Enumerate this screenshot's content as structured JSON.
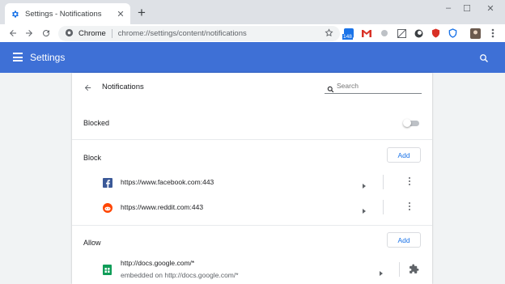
{
  "browser": {
    "tab_title": "Settings - Notifications",
    "omnibox_scheme": "Chrome",
    "omnibox_url": "chrome://settings/content/notifications",
    "extension_badge": "148"
  },
  "header": {
    "title": "Settings"
  },
  "page": {
    "title": "Notifications",
    "search_placeholder": "Search",
    "blocked_label": "Blocked",
    "blocked_toggle_on": false
  },
  "block_section": {
    "heading": "Block",
    "add_label": "Add",
    "sites": [
      {
        "url": "https://www.facebook.com:443",
        "icon": "facebook-icon"
      },
      {
        "url": "https://www.reddit.com:443",
        "icon": "reddit-icon"
      }
    ]
  },
  "allow_section": {
    "heading": "Allow",
    "add_label": "Add",
    "sites": [
      {
        "url": "http://docs.google.com/*",
        "sub": "embedded on http://docs.google.com/*",
        "icon": "google-sheets-icon",
        "action_icon": "puzzle-icon"
      }
    ]
  },
  "colors": {
    "accent": "#3e70d6",
    "link": "#1a73e8"
  }
}
